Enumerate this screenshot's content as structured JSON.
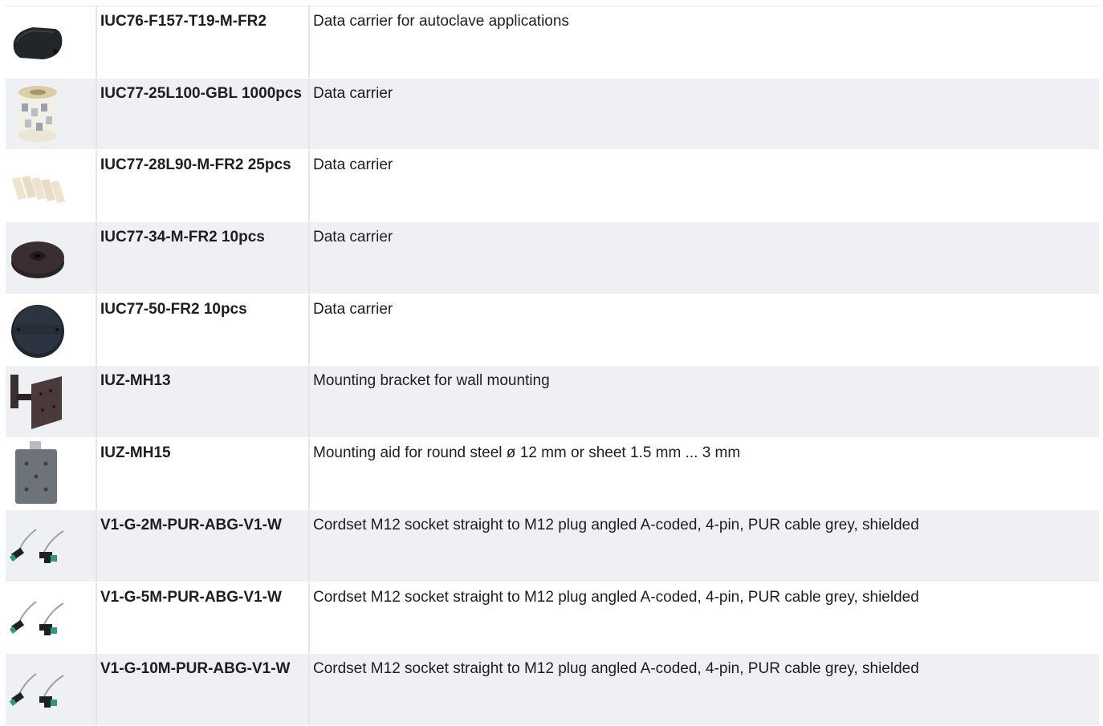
{
  "products": [
    {
      "code": "IUC76-F157-T19-M-FR2",
      "description": "Data carrier for autoclave applications",
      "image_icon": "black-tag-icon"
    },
    {
      "code": "IUC77-25L100-GBL 1000pcs",
      "description": "Data carrier",
      "image_icon": "label-roll-icon"
    },
    {
      "code": "IUC77-28L90-M-FR2 25pcs",
      "description": "Data carrier",
      "image_icon": "label-strips-icon"
    },
    {
      "code": "IUC77-34-M-FR2 10pcs",
      "description": "Data carrier",
      "image_icon": "round-disc-tag-icon"
    },
    {
      "code": "IUC77-50-FR2 10pcs",
      "description": "Data carrier",
      "image_icon": "round-eared-tag-icon"
    },
    {
      "code": "IUZ-MH13",
      "description": "Mounting bracket for wall mounting",
      "image_icon": "wall-bracket-icon"
    },
    {
      "code": "IUZ-MH15",
      "description": "Mounting aid for round steel ø 12 mm or sheet 1.5 mm ... 3 mm",
      "image_icon": "mounting-plate-icon"
    },
    {
      "code": "V1-G-2M-PUR-ABG-V1-W",
      "description": "Cordset M12 socket straight to M12 plug angled A-coded, 4-pin, PUR cable grey, shielded",
      "image_icon": "cordset-icon"
    },
    {
      "code": "V1-G-5M-PUR-ABG-V1-W",
      "description": "Cordset M12 socket straight to M12 plug angled A-coded, 4-pin, PUR cable grey, shielded",
      "image_icon": "cordset-icon"
    },
    {
      "code": "V1-G-10M-PUR-ABG-V1-W",
      "description": "Cordset M12 socket straight to M12 plug angled A-coded, 4-pin, PUR cable grey, shielded",
      "image_icon": "cordset-icon"
    }
  ],
  "colors": {
    "row_alt": "#eef0f3",
    "separator": "#e3e6e9",
    "text": "#1e1e1e",
    "cordset_green": "#2f9a7a"
  }
}
